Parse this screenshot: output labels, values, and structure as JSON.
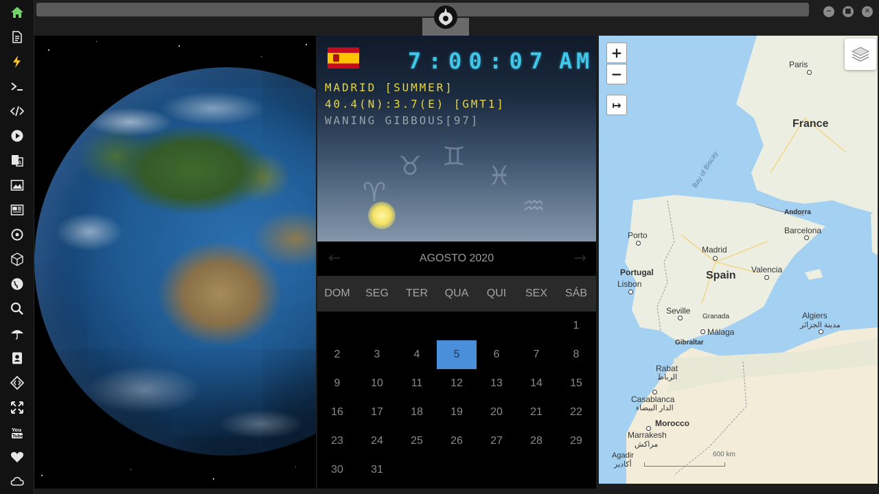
{
  "sidebar": {
    "icons": [
      "home-icon",
      "document-icon",
      "lightning-icon",
      "terminal-icon",
      "code-icon",
      "play-icon",
      "translate-icon",
      "image-icon",
      "newspaper-icon",
      "gear-icon",
      "cube-icon",
      "globe-icon",
      "search-icon",
      "umbrella-icon",
      "contact-card-icon",
      "diamond-code-icon",
      "expand-icon",
      "youtube-icon",
      "heart-icon",
      "cloud-icon"
    ]
  },
  "window": {
    "controls": [
      "minimize",
      "maximize",
      "close"
    ]
  },
  "clock": {
    "time": "7:00:07",
    "ampm": "AM",
    "city": "MADRID [SUMMER]",
    "coords": "40.4(N):3.7(E) [GMT1]",
    "moon": "WANING GIBBOUS[97]"
  },
  "calendar": {
    "month": "AGOSTO 2020",
    "prev": "←",
    "next": "→",
    "weekdays": [
      "DOM",
      "SEG",
      "TER",
      "QUA",
      "QUI",
      "SEX",
      "SÁB"
    ],
    "days": [
      [
        "",
        "",
        "",
        "",
        "",
        "",
        "1"
      ],
      [
        "2",
        "3",
        "4",
        "5",
        "6",
        "7",
        "8"
      ],
      [
        "9",
        "10",
        "11",
        "12",
        "13",
        "14",
        "15"
      ],
      [
        "16",
        "17",
        "18",
        "19",
        "20",
        "21",
        "22"
      ],
      [
        "23",
        "24",
        "25",
        "26",
        "27",
        "28",
        "29"
      ],
      [
        "30",
        "31",
        "",
        "",
        "",
        "",
        ""
      ]
    ],
    "selected": "5"
  },
  "map": {
    "zoom_in": "+",
    "zoom_out": "−",
    "pin": "↦",
    "labels": {
      "paris": "Paris",
      "france": "France",
      "bay": "Bay of Biscay",
      "andorra": "Andorra",
      "porto": "Porto",
      "madrid": "Madrid",
      "barcelona": "Barcelona",
      "portugal": "Portugal",
      "spain": "Spain",
      "valencia": "Valencia",
      "lisbon": "Lisbon",
      "seville": "Seville",
      "granada": "Granada",
      "algiers": "Algiers",
      "algiers_ar": "مدينة الجزائر",
      "malaga": "Málaga",
      "gibraltar": "Gibraltar",
      "rabat": "Rabat",
      "rabat_ar": "الرباط",
      "casablanca": "Casablanca",
      "casablanca_ar": "الدار البيضاء",
      "morocco": "Morocco",
      "marrakesh": "Marrakesh",
      "marrakesh_ar": "مراكش",
      "agadir": "Agadir",
      "agadir_ar": "أكادير",
      "scale": "600 km"
    }
  }
}
